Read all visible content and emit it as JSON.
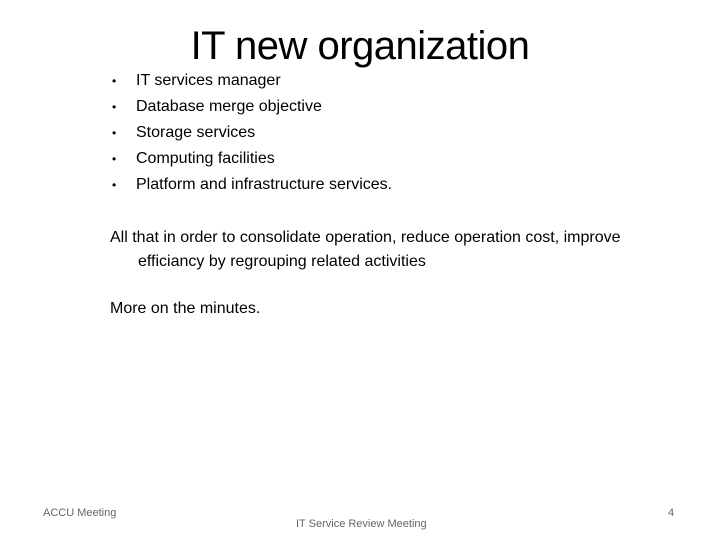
{
  "slide": {
    "title": "IT new organization",
    "bullet_glyph": "•",
    "bullets": [
      "IT services manager",
      "Database merge objective",
      "Storage services",
      "Computing facilities",
      "Platform and infrastructure services."
    ],
    "paragraph": {
      "line1": "All that in order to consolidate operation, reduce operation cost, improve",
      "line2": "efficiancy by regrouping related activities"
    },
    "paragraph2": "More on the minutes."
  },
  "footer": {
    "left": "ACCU Meeting",
    "center": "IT Service Review Meeting",
    "page_number": "4"
  }
}
